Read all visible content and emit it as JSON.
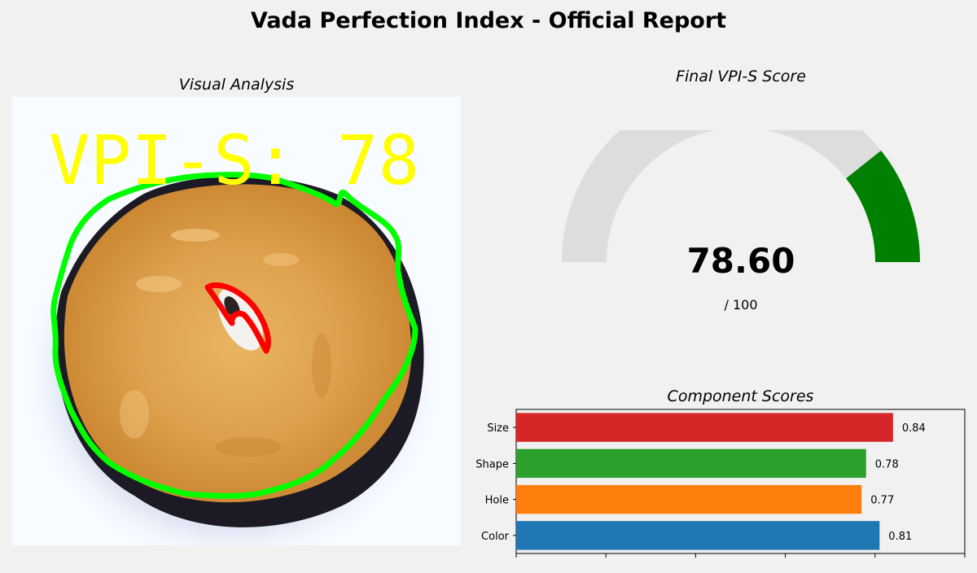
{
  "header": {
    "title": "Vada Perfection Index - Official Report"
  },
  "visual": {
    "title": "Visual Analysis",
    "overlay_text": "VPI-S: 78",
    "overlay_color": "#ffff00",
    "contour_color": "#00ff00",
    "hole_contour_color": "#ff0000"
  },
  "gauge": {
    "title": "Final VPI-S Score",
    "score_label": "78.60",
    "max_label": "/ 100",
    "value": 78.6,
    "max": 100,
    "fill_color": "#008000",
    "track_color": "#dddddd"
  },
  "chart_data": {
    "type": "bar",
    "orientation": "horizontal",
    "title": "Component Scores",
    "categories": [
      "Color",
      "Hole",
      "Shape",
      "Size"
    ],
    "values": [
      0.81,
      0.77,
      0.78,
      0.84
    ],
    "value_labels": [
      "0.81",
      "0.77",
      "0.78",
      "0.84"
    ],
    "colors": [
      "#1f77b4",
      "#ff7f0e",
      "#2ca02c",
      "#d62728"
    ],
    "xlim": [
      0,
      1
    ],
    "xticks": [
      0,
      0.2,
      0.4,
      0.6,
      0.8,
      1.0
    ],
    "grid": false,
    "xlabel": "",
    "ylabel": ""
  }
}
